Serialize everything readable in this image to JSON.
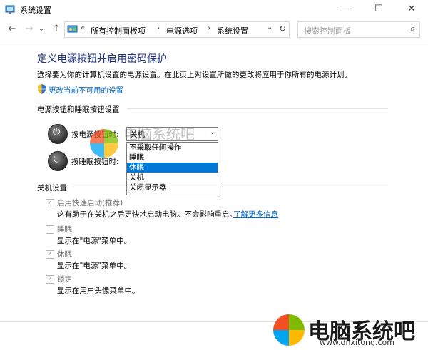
{
  "window": {
    "title": "系统设置",
    "minimize_glyph": "—",
    "maximize_glyph": "☐",
    "close_glyph": "✕"
  },
  "nav": {
    "back_glyph": "←",
    "forward_glyph": "→",
    "recent_glyph": "⌄",
    "up_glyph": "↑",
    "overflow_glyph": "«",
    "breadcrumbs": [
      "所有控制面板项",
      "电源选项",
      "系统设置"
    ],
    "sep_glyph": "›",
    "dropdown_glyph": "⌄",
    "refresh_glyph": "↻",
    "search_placeholder": "搜索控制面板",
    "search_icon_glyph": "⌕"
  },
  "main": {
    "title": "定义电源按钮并启用密码保护",
    "description": "选择要为你的计算机设置的电源设置。在此页上对设置所做的更改将应用于你所有的电源计划。",
    "change_link": "更改当前不可用的设置"
  },
  "power_section": {
    "heading": "电源按钮和睡眠按钮设置",
    "power_button_label": "按电源按钮时:",
    "sleep_button_label": "按睡眠按钮时:",
    "power_button_value": "关机",
    "dropdown_options": [
      {
        "label": "不采取任何操作",
        "selected": false
      },
      {
        "label": "睡眠",
        "selected": false
      },
      {
        "label": "休眠",
        "selected": true
      },
      {
        "label": "关机",
        "selected": false
      },
      {
        "label": "关闭显示器",
        "selected": false
      }
    ]
  },
  "shutdown_section": {
    "heading": "关机设置",
    "items": [
      {
        "label": "启用快速启动(推荐)",
        "checked": true,
        "desc": "这有助于在关机之后更快地启动电脑。不会影响重启。",
        "link": "了解更多信息"
      },
      {
        "label": "睡眠",
        "checked": false,
        "desc": "显示在\"电源\"菜单中。"
      },
      {
        "label": "休眠",
        "checked": true,
        "desc": "显示在\"电源\"菜单中。"
      },
      {
        "label": "锁定",
        "checked": true,
        "desc": "显示在用户头像菜单中。"
      }
    ]
  },
  "watermark": {
    "text": "电脑系统吧",
    "url": "www.dnxitong.com",
    "small_url": "itong.com",
    "colors": [
      "#f25022",
      "#7fba00",
      "#00a4ef",
      "#ffb900"
    ]
  },
  "colors": {
    "title_blue": "#1e3287",
    "link_blue": "#0066cc",
    "selection": "#0078d7"
  }
}
